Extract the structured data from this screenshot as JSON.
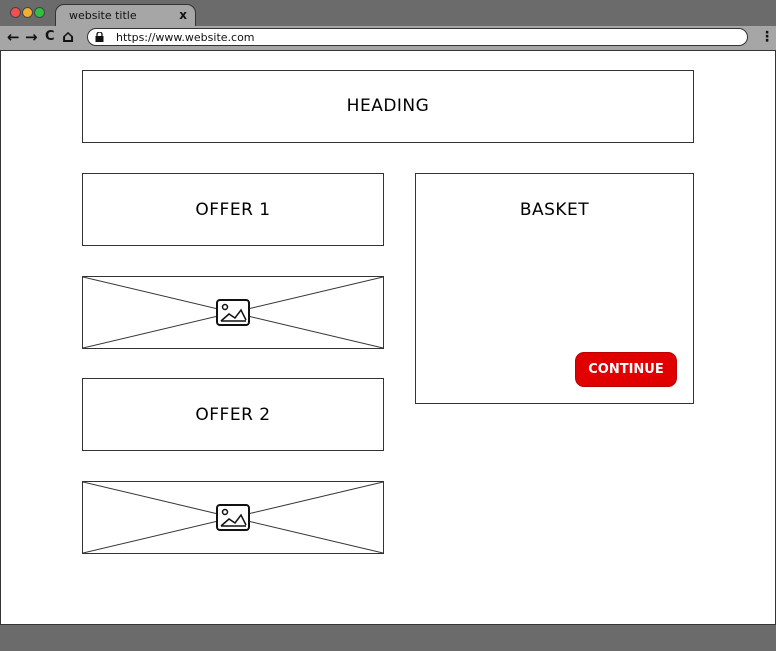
{
  "browser": {
    "tab_title": "website title",
    "tab_close": "x",
    "url": "https://www.website.com",
    "window_controls": {
      "close_color": "#f05050",
      "minimize_color": "#f0b030",
      "maximize_color": "#30c040"
    },
    "nav_icons": {
      "back": "←",
      "forward": "→",
      "reload": "C",
      "home": "⌂",
      "menu": "⋮"
    }
  },
  "page": {
    "heading": "HEADING",
    "offers": [
      {
        "label": "OFFER 1"
      },
      {
        "label": "OFFER 2"
      }
    ],
    "basket": {
      "title": "BASKET",
      "continue_label": "CONTINUE",
      "continue_color": "#e00000"
    }
  }
}
